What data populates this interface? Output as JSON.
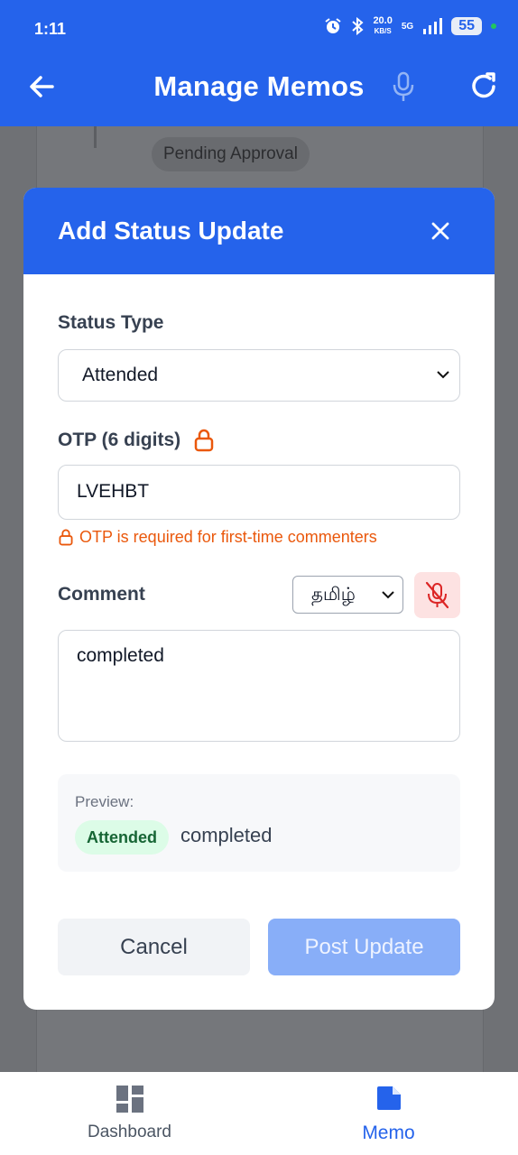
{
  "status_bar": {
    "time": "1:11",
    "net_speed": "20.0",
    "net_unit": "KB/S",
    "network": "5G",
    "battery": "55"
  },
  "header": {
    "title": "Manage Memos",
    "icons": [
      "back-arrow-icon",
      "microphone-icon",
      "refresh-icon"
    ]
  },
  "background_page": {
    "badge": "Pending Approval"
  },
  "modal": {
    "title": "Add Status Update",
    "status_type": {
      "label": "Status Type",
      "selected": "Attended"
    },
    "otp": {
      "label": "OTP (6 digits)",
      "value": "LVEHBT",
      "error": "OTP is required for first-time commenters"
    },
    "comment": {
      "label": "Comment",
      "language": "தமிழ்",
      "value": "completed"
    },
    "preview": {
      "label": "Preview:",
      "badge": "Attended",
      "text": "completed"
    },
    "cancel_label": "Cancel",
    "post_label": "Post Update"
  },
  "bottom_nav": {
    "items": [
      {
        "label": "Dashboard",
        "active": false
      },
      {
        "label": "Memo",
        "active": true
      }
    ]
  },
  "colors": {
    "primary": "#2563eb",
    "error": "#ea580c",
    "success_bg": "#dcfce7",
    "success_text": "#166534",
    "disabled_button": "#88aef8"
  }
}
